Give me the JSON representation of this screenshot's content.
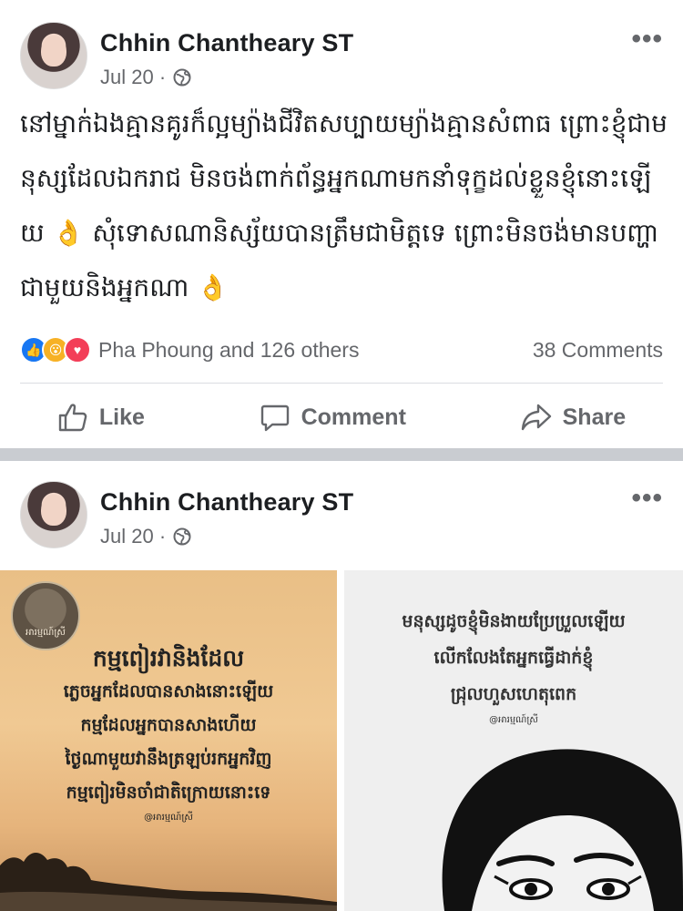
{
  "posts": [
    {
      "author": "Chhin Chantheary ST",
      "date": "Jul 20 ·",
      "more_label": "•••",
      "text": "នៅម្នាក់ឯងគ្មានគូរក៏ល្អម្យ៉ាងជីវិតសប្បាយម្យ៉ាងគ្មានសំពាធ ព្រោះខ្ញុំជាមនុស្សដែលឯករាជ មិនចង់ពាក់ព័ន្ធអ្នកណាមកនាំទុក្ខដល់ខ្លួនខ្ញុំនោះឡើយ 👌 សុំទោសណានិស្ស័យបានត្រឹមជាមិត្តទេ ព្រោះមិនចង់មានបញ្ហាជាមួយនិងអ្នកណា 👌",
      "reactions_text": "Pha Phoung and 126 others",
      "comments_text": "38 Comments",
      "actions": {
        "like": "Like",
        "comment": "Comment",
        "share": "Share"
      }
    },
    {
      "author": "Chhin Chantheary ST",
      "date": "Jul 20 ·",
      "more_label": "•••",
      "image_left": {
        "logo": "អារម្មណ៍ស្រី",
        "lines": [
          "កម្មពៀរវានិងដែល",
          "ភ្លេចអ្នកដែលបានសាងនោះឡើយ",
          "កម្មដែលអ្នកបានសាងហើយ",
          "ថ្ងៃណាមួយវានឹងត្រឡប់រកអ្នកវិញ",
          "កម្មពៀរមិនចាំជាតិក្រោយនោះទេ"
        ],
        "handle": "@អារម្មណ៍ស្រី"
      },
      "image_right": {
        "lines": [
          "មនុស្សដូចខ្ញុំមិនងាយប្រែប្រួលឡើយ",
          "លើកលែងតែអ្នកធ្វើដាក់ខ្ញុំ",
          "ជ្រុលហួសហេតុពេក"
        ],
        "handle": "@អារម្មណ៍ស្រី"
      }
    }
  ],
  "colors": {
    "like_blue": "#1877f2",
    "wow_yellow": "#f7b125",
    "love_red": "#f33e58",
    "meta_gray": "#65676b"
  },
  "icons": [
    "globe-icon",
    "like-icon",
    "comment-icon",
    "share-icon",
    "more-icon"
  ]
}
